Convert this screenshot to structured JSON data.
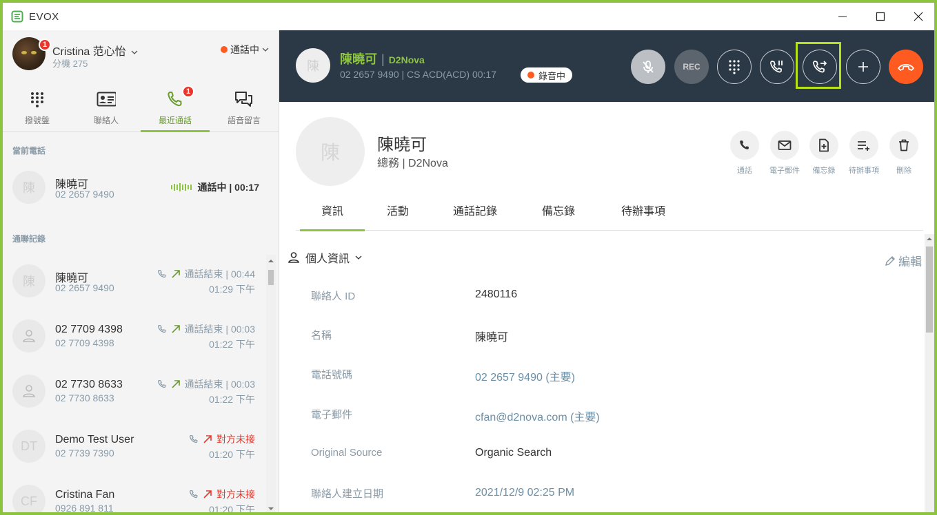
{
  "window": {
    "title": "EVOX"
  },
  "user": {
    "name": "Cristina 范心怡",
    "extension": "分機 275",
    "badge": "1",
    "status": "通話中"
  },
  "nav_tabs": [
    {
      "label": "撥號盤",
      "icon": "dialpad-icon"
    },
    {
      "label": "聯絡人",
      "icon": "contact-card-icon"
    },
    {
      "label": "最近通話",
      "icon": "phone-icon",
      "badge": "1",
      "active": true
    },
    {
      "label": "語音留言",
      "icon": "voicemail-icon"
    }
  ],
  "current_section": "當前電話",
  "current_call": {
    "avatar": "陳",
    "name": "陳曉可",
    "number": "02 2657 9490",
    "status": "通話中 | 00:17"
  },
  "history_section": "通聯記錄",
  "history": [
    {
      "avatar": "陳",
      "name": "陳曉可",
      "number": "02 2657 9490",
      "status": "通話結束 | 00:44",
      "time": "01:29 下午",
      "type": "ended"
    },
    {
      "avatar": "",
      "name": "02 7709 4398",
      "number": "02 7709 4398",
      "status": "通話結束 | 00:03",
      "time": "01:22 下午",
      "type": "ended"
    },
    {
      "avatar": "",
      "name": "02 7730 8633",
      "number": "02 7730 8633",
      "status": "通話結束 | 00:03",
      "time": "01:22 下午",
      "type": "ended"
    },
    {
      "avatar": "DT",
      "name": "Demo Test User",
      "number": "02 7739 7390",
      "status": "對方未接",
      "time": "01:20 下午",
      "type": "missed"
    },
    {
      "avatar": "CF",
      "name": "Cristina Fan",
      "number": "0926 891 811",
      "status": "對方未接",
      "time": "01:20 下午",
      "type": "missed"
    }
  ],
  "active_call": {
    "avatar": "陳",
    "name": "陳曉可",
    "company": "D2Nova",
    "details": "02 2657 9490 | CS ACD(ACD)  00:17",
    "recording_label": "錄音中",
    "rec_button": "REC"
  },
  "contact": {
    "avatar": "陳",
    "name": "陳曉可",
    "subtitle": "總務 | D2Nova",
    "actions": [
      "通話",
      "電子郵件",
      "備忘錄",
      "待辦事項",
      "刪除"
    ]
  },
  "tabs": [
    "資訊",
    "活動",
    "通話記錄",
    "備忘錄",
    "待辦事項"
  ],
  "section": {
    "title": "個人資訊",
    "edit": "編輯"
  },
  "fields": [
    {
      "label": "聯絡人 ID",
      "value": "2480116",
      "link": false
    },
    {
      "label": "名稱",
      "value": "陳曉可",
      "link": false
    },
    {
      "label": "電話號碼",
      "value": "02 2657 9490 (主要)",
      "link": true
    },
    {
      "label": "電子郵件",
      "value": "cfan@d2nova.com (主要)",
      "link": true
    },
    {
      "label": "Original Source",
      "value": "Organic Search",
      "link": false
    },
    {
      "label": "聯絡人建立日期",
      "value": "2021/12/9 02:25 PM",
      "link": true
    }
  ],
  "colors": {
    "accent": "#8cc43f",
    "call_bar": "#2b3845",
    "hangup": "#ff5a1f",
    "missed": "#e8362c",
    "highlight": "#b7e21b"
  }
}
